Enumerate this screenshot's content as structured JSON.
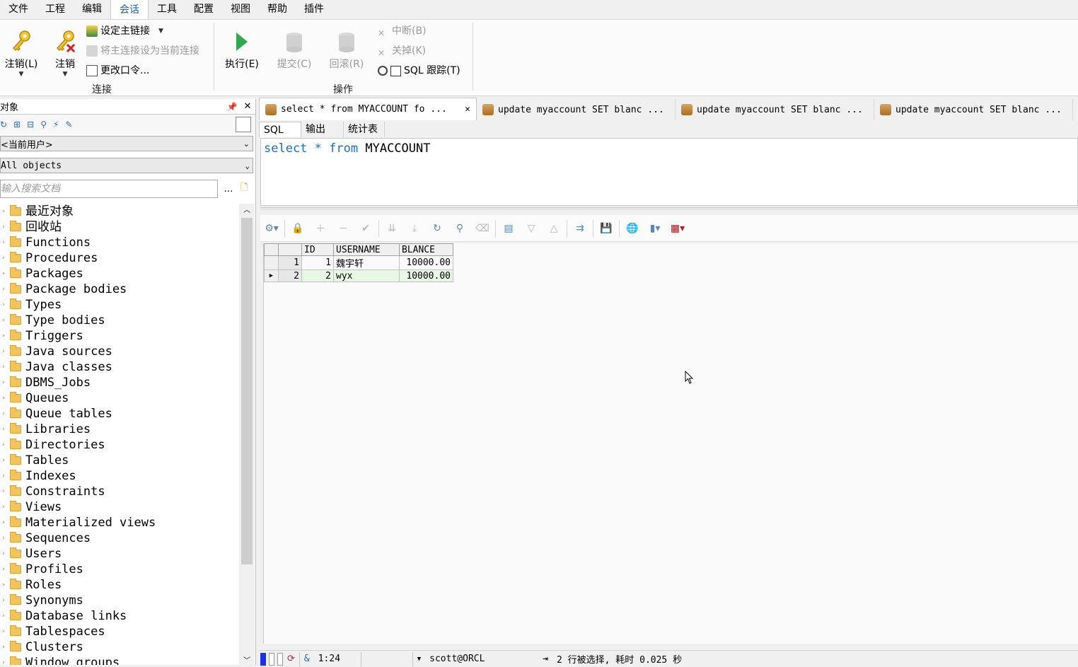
{
  "menu": [
    "文件",
    "工程",
    "编辑",
    "会话",
    "工具",
    "配置",
    "视图",
    "帮助",
    "插件"
  ],
  "menu_active": "会话",
  "ribbon": {
    "logon_label": "注销(L)",
    "logoff_label": "注销",
    "set_primary": "设定主链接",
    "set_primary_current": "将主连接设为当前连接",
    "change_password": "更改口令...",
    "connection_group": "连接",
    "execute_label": "执行(E)",
    "commit_label": "提交(C)",
    "rollback_label": "回滚(R)",
    "break_label": "中断(B)",
    "close_label": "关掉(K)",
    "sql_trace_label": "SQL 跟踪(T)",
    "operation_group": "操作"
  },
  "object_panel": {
    "title": "对象",
    "user_combo": "<当前用户>",
    "filter_combo": "All objects",
    "search_placeholder": "输入搜索文档",
    "tree_items": [
      "最近对象",
      "回收站",
      "Functions",
      "Procedures",
      "Packages",
      "Package bodies",
      "Types",
      "Type bodies",
      "Triggers",
      "Java sources",
      "Java classes",
      "DBMS_Jobs",
      "Queues",
      "Queue tables",
      "Libraries",
      "Directories",
      "Tables",
      "Indexes",
      "Constraints",
      "Views",
      "Materialized views",
      "Sequences",
      "Users",
      "Profiles",
      "Roles",
      "Synonyms",
      "Database links",
      "Tablespaces",
      "Clusters",
      "Window groups"
    ]
  },
  "editor_tabs": [
    "select * from MYACCOUNT fo ...",
    "update myaccount SET blanc ...",
    "update myaccount SET blanc ...",
    "update myaccount SET blanc ..."
  ],
  "sub_tabs": [
    "SQL",
    "输出",
    "统计表"
  ],
  "sql": {
    "kw1": "select",
    "star": "*",
    "kw2": "from",
    "table": "MYACCOUNT"
  },
  "grid": {
    "columns": [
      "ID",
      "USERNAME",
      "BLANCE"
    ],
    "rows": [
      {
        "rownum": "1",
        "id": "1",
        "username": "魏宇轩",
        "blance": "10000.00"
      },
      {
        "rownum": "2",
        "id": "2",
        "username": "wyx",
        "blance": "10000.00"
      }
    ]
  },
  "status": {
    "position": "1:24",
    "connection": "scott@ORCL",
    "message": "2 行被选择, 耗时 0.025 秒"
  }
}
